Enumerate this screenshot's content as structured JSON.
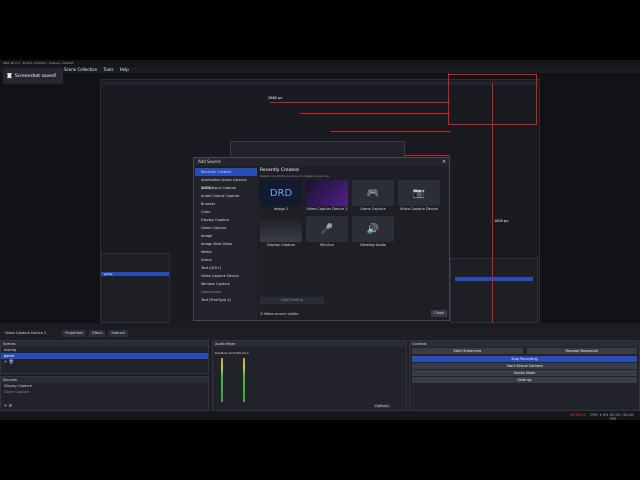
{
  "window": {
    "title": "OBS 30.2.3 - Profile: Untitled - Scenes: Untitled"
  },
  "menu": [
    "File",
    "Edit",
    "View",
    "Docks",
    "Profile",
    "Scene Collection",
    "Tools",
    "Help"
  ],
  "toast": {
    "text": "Screenshot saved!"
  },
  "scene_tabs": {
    "active_source": "Video Capture Device 2",
    "properties": "Properties",
    "filters": "Filters",
    "interact": "Interact"
  },
  "scenes": {
    "title": "Scenes",
    "items": [
      "testing",
      "game"
    ],
    "selected": 1
  },
  "sources": {
    "title": "Sources",
    "items": [
      "Display Capture",
      "Game Capture"
    ]
  },
  "mixer": {
    "title": "Audio Mixer",
    "ch1": "Desktop Audio",
    "ch2": "Mic/Aux",
    "db1": "0.0 dB",
    "db2": "0.0 dB"
  },
  "controls": {
    "title": "Controls",
    "buttons": [
      "Start Streaming",
      "Stop Recording",
      "Start Virtual Camera",
      "Studio Mode",
      "Settings"
    ],
    "snapshot": "Manage Broadcast"
  },
  "dialog": {
    "title": "Add Source",
    "section": "Recently Created",
    "hint": "Select one of the sources or create a new one",
    "source_list": [
      "Recently Created",
      "Application Audio Capture (BETA)",
      "Audio Input Capture",
      "Audio Output Capture",
      "Browser",
      "Color",
      "Display Capture",
      "Game Capture",
      "Image",
      "Image Slide Show",
      "Media",
      "Scene",
      "Text (GDI+)",
      "Video Capture Device",
      "Window Capture"
    ],
    "deprecated_header": "Deprecated",
    "deprecated": "Text (FreeType 2)",
    "tiles": [
      {
        "label": "Image 2",
        "icon": "DRD"
      },
      {
        "label": "Video Capture Device 2",
        "icon": ""
      },
      {
        "label": "Game Capture",
        "icon": "🎮"
      },
      {
        "label": "Video Capture Device",
        "icon": "📷"
      },
      {
        "label": "Display Capture",
        "icon": ""
      },
      {
        "label": "Mic/Aux",
        "icon": "🎤"
      },
      {
        "label": "Desktop Audio",
        "icon": "🔊"
      }
    ],
    "add_existing": "Add Existing",
    "make_visible": "Make source visible",
    "close": "Close"
  },
  "status": {
    "cpu": "CPU: 1.9%",
    "fps": "60.00 / 60.00 FPS",
    "rec": "00:00:41"
  },
  "annot": {
    "a": "2880 px",
    "b": "1620 px"
  },
  "colors": {
    "accent": "#284cb8",
    "annotation": "#d21e1e"
  }
}
